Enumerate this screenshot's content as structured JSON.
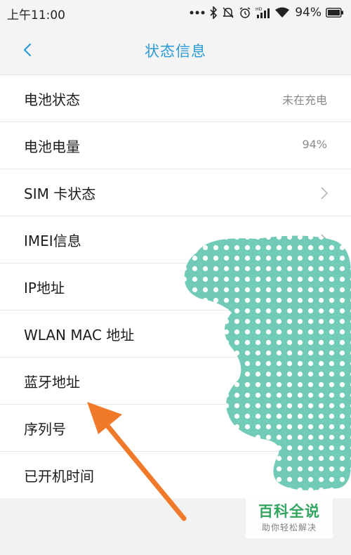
{
  "status_bar": {
    "time": "上午11:00",
    "battery_percent": "94%",
    "icons": [
      "more-icon",
      "bluetooth-icon",
      "mute-icon",
      "alarm-icon",
      "hd-signal-icon",
      "wifi-icon",
      "battery-icon"
    ]
  },
  "header": {
    "title": "状态信息",
    "back_icon": "chevron-left-icon",
    "accent_color": "#2a9bd6"
  },
  "rows": [
    {
      "label": "电池状态",
      "value": "未在充电"
    },
    {
      "label": "电池电量",
      "value": "94%"
    },
    {
      "label": "SIM 卡状态",
      "value": ""
    },
    {
      "label": "IMEI信息",
      "value": ""
    },
    {
      "label": "IP地址",
      "value": ""
    },
    {
      "label": "WLAN MAC 地址",
      "value": ""
    },
    {
      "label": "蓝牙地址",
      "value": ""
    },
    {
      "label": "序列号",
      "value": ""
    },
    {
      "label": "已开机时间",
      "value": ""
    }
  ],
  "annotation": {
    "arrow_color": "#f07a2a",
    "redaction_color": "#72cbb6"
  },
  "watermark": {
    "title": "百科全说",
    "subtitle": "助你轻松解决",
    "color": "#2aa05a"
  }
}
